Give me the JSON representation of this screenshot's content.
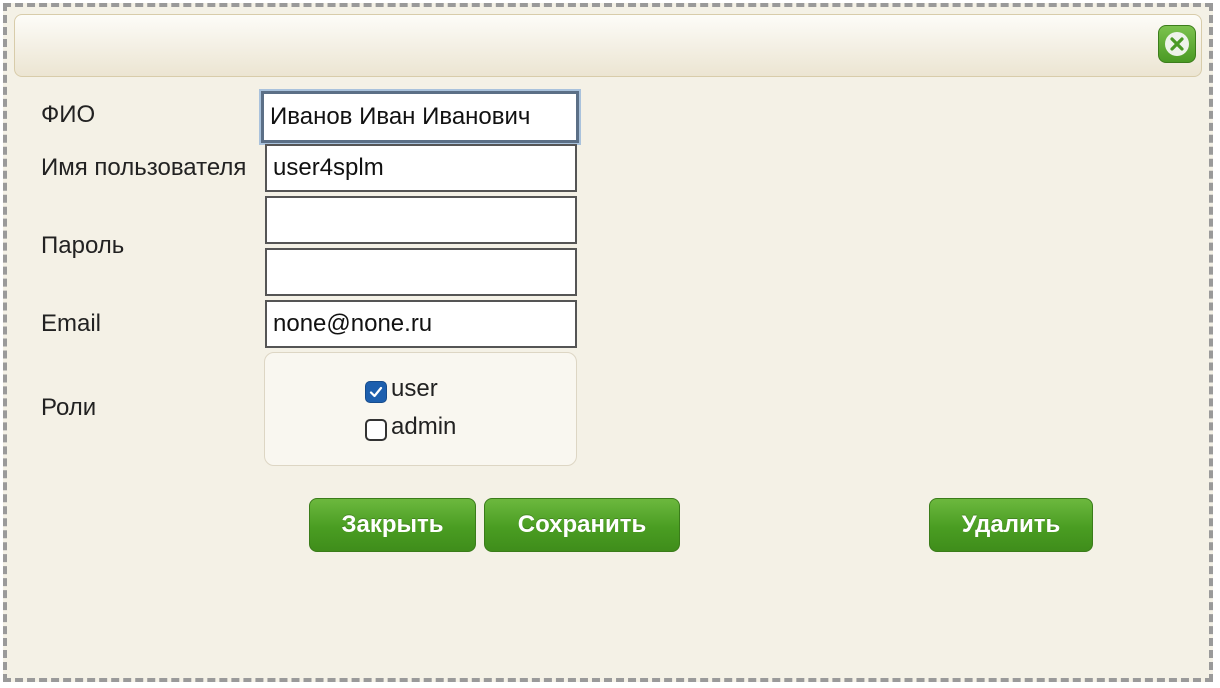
{
  "dialog": {
    "close_icon": "close-icon"
  },
  "form": {
    "fio_label": "ФИО",
    "fio_value": "Иванов Иван Иванович",
    "username_label": "Имя пользователя",
    "username_value": "user4splm",
    "password_label": "Пароль",
    "password_value": "",
    "password_confirm_value": "",
    "email_label": "Email",
    "email_value": "none@none.ru",
    "roles_label": "Роли",
    "roles": [
      {
        "label": "user",
        "checked": true
      },
      {
        "label": "admin",
        "checked": false
      }
    ]
  },
  "buttons": {
    "close_label": "Закрыть",
    "save_label": "Сохранить",
    "delete_label": "Удалить"
  },
  "colors": {
    "accent_green": "#4a9d22",
    "checkbox_blue": "#1d5fae",
    "background": "#f4f1e6"
  }
}
